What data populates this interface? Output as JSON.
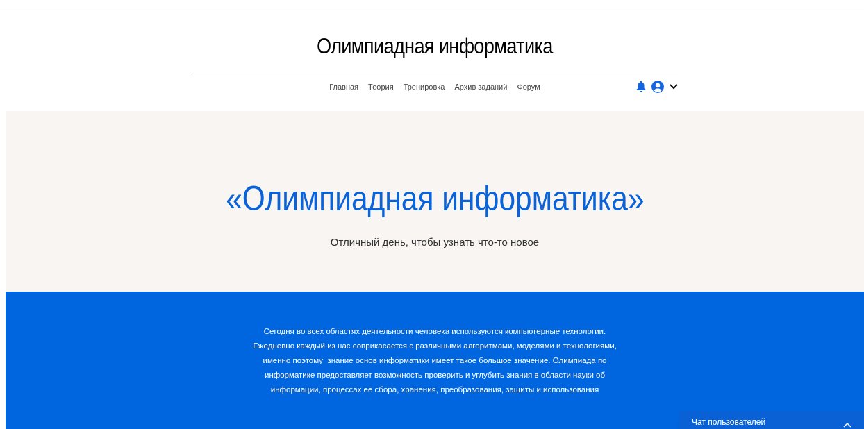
{
  "site_title": "Олимпиадная информатика",
  "nav": [
    "Главная",
    "Теория",
    "Тренировка",
    "Архив заданий",
    "Форум"
  ],
  "hero": {
    "heading": "«Олимпиадная информатика»",
    "subheading": "Отличный день, чтобы узнать что-то новое"
  },
  "about": [
    "Сегодня во всех областях деятельности человека используются компьютерные технологии.",
    "Ежедневно каждый из нас соприкасается с различными алгоритмами, моделями и технологиями,",
    "именно поэтому  знание основ информатики имеет такое большое значение. Олимпиада по",
    "информатике предоставляет возможность проверить и углубить знания в области науки об",
    "информации, процессах ее сбора, хранения, преобразования, защиты и использования"
  ],
  "chat": {
    "title": "Чат пользователей"
  }
}
